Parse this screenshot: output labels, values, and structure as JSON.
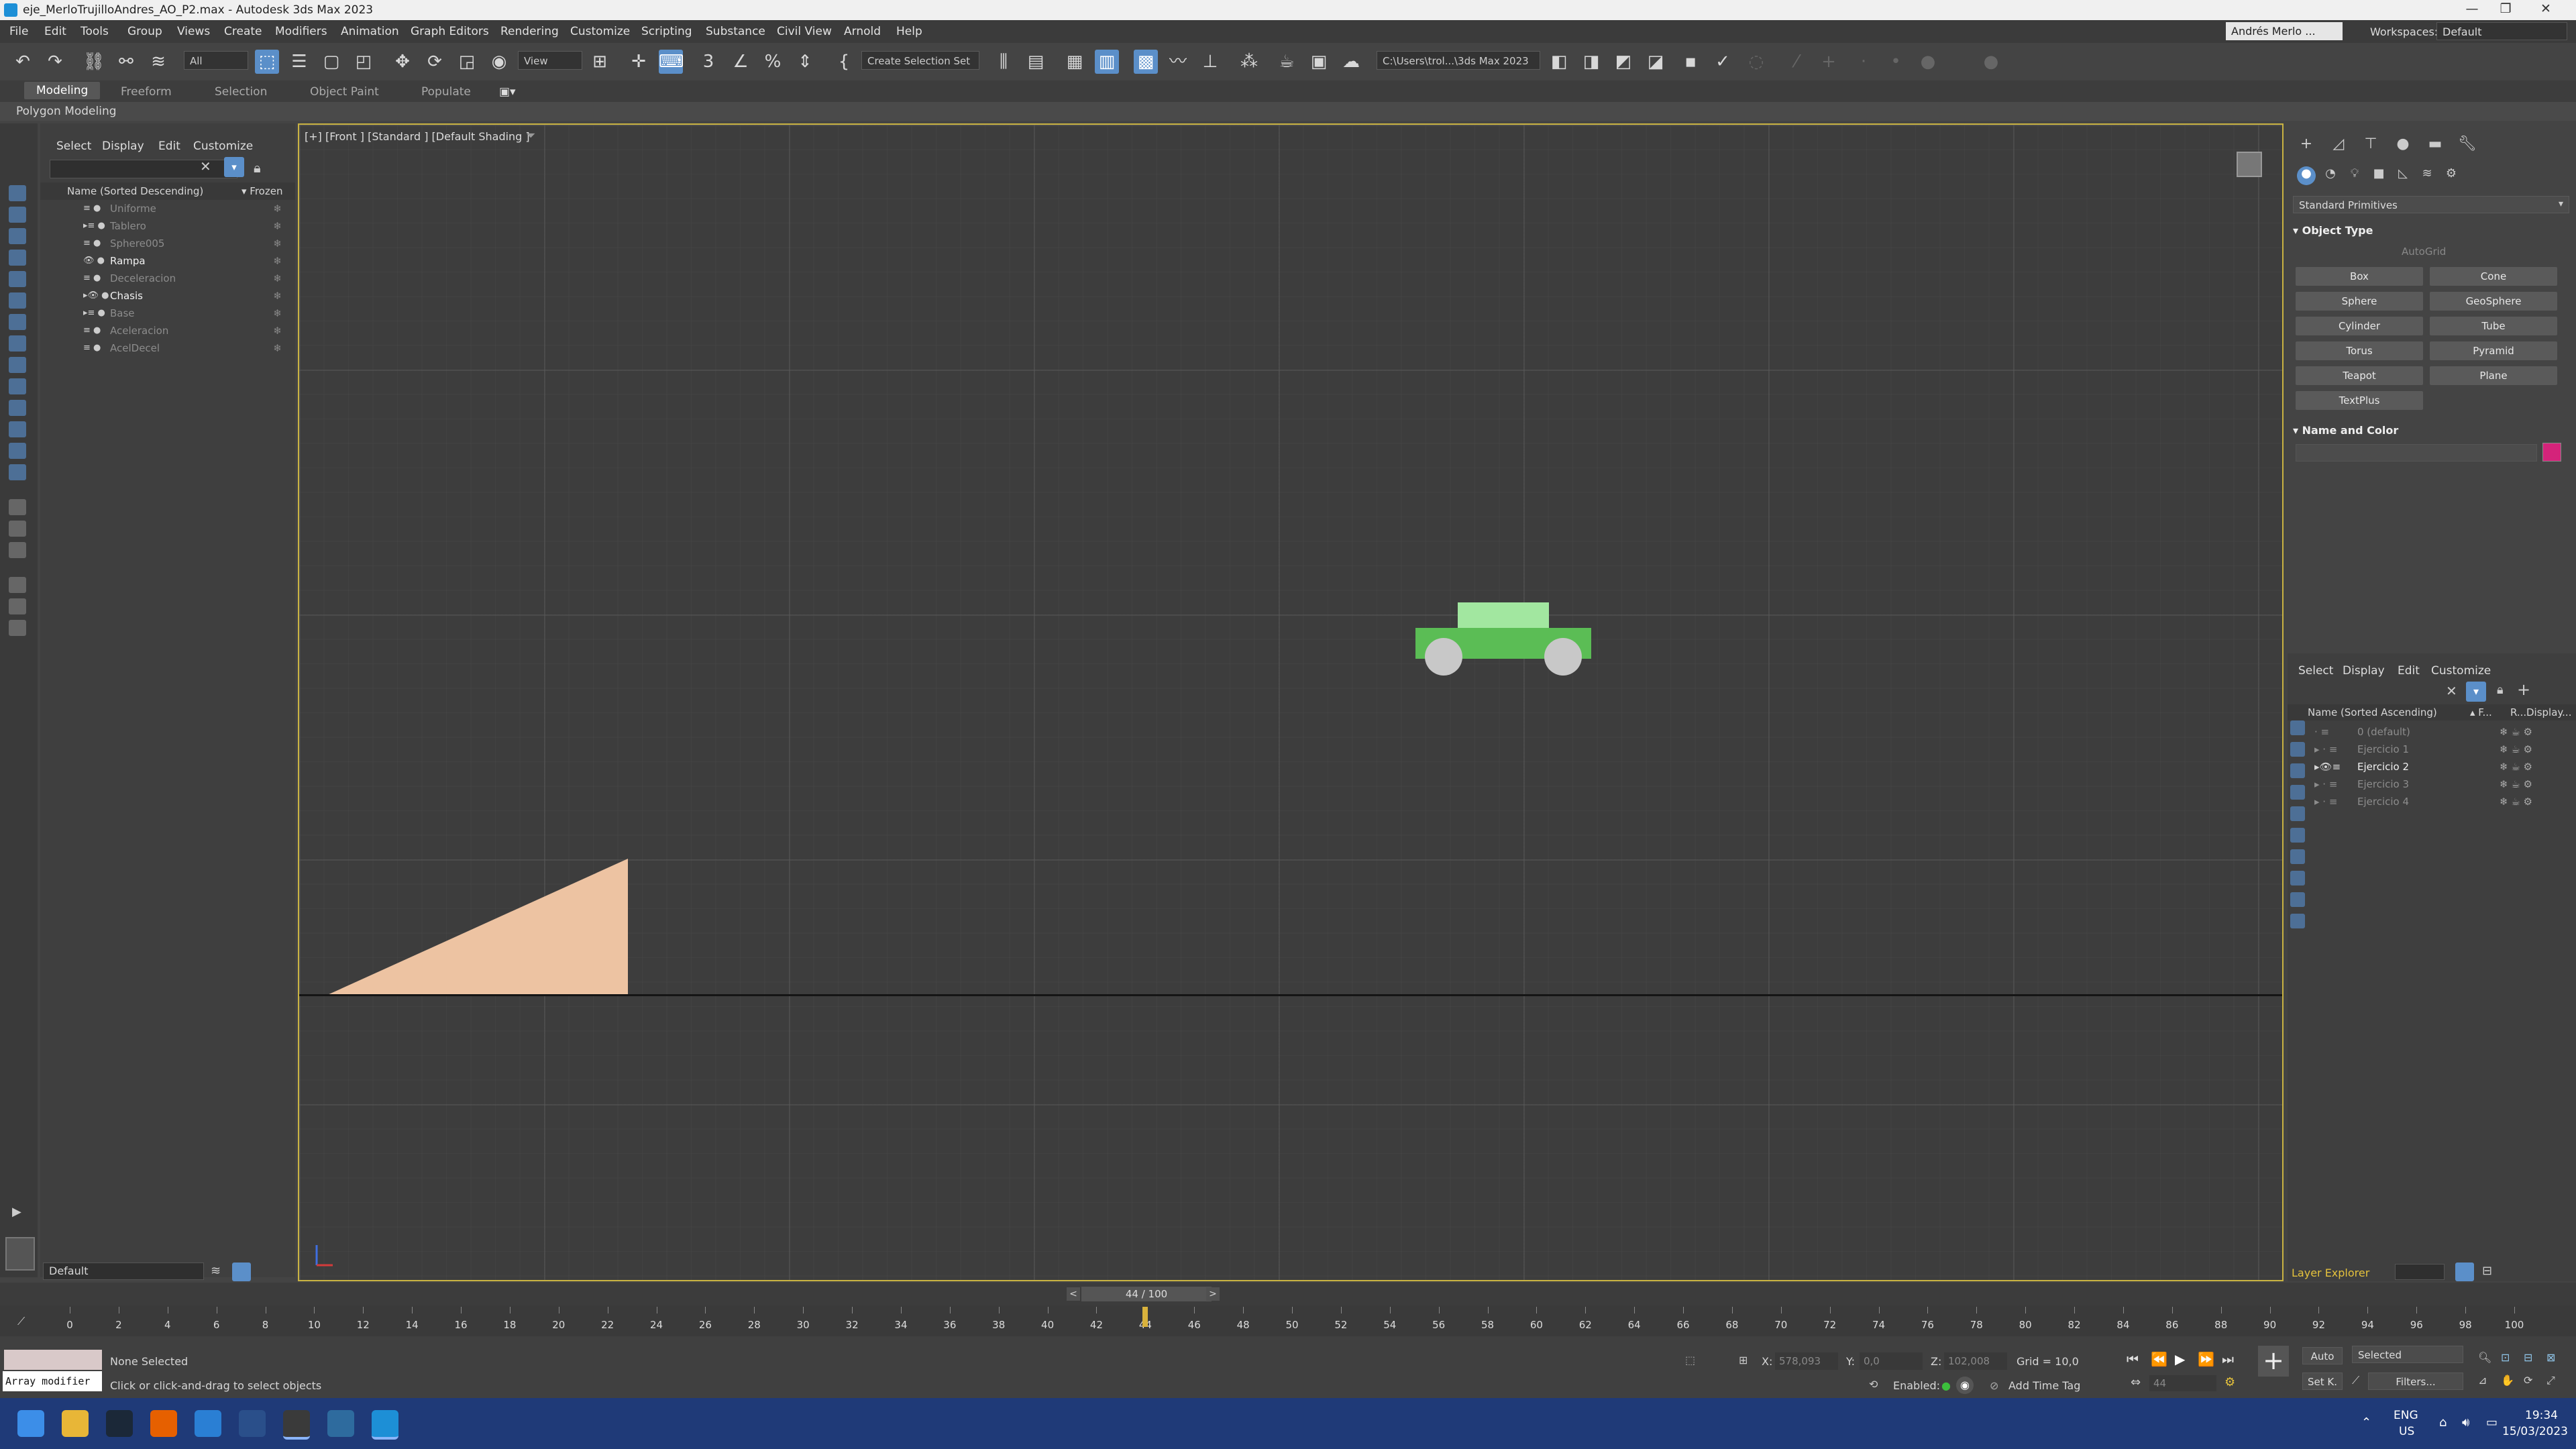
{
  "window": {
    "title": "eje_MerloTrujilloAndres_AO_P2.max - Autodesk 3ds Max 2023",
    "minimize": "—",
    "maximize": "❐",
    "close": "✕"
  },
  "menu": [
    "File",
    "Edit",
    "Tools",
    "Group",
    "Views",
    "Create",
    "Modifiers",
    "Animation",
    "Graph Editors",
    "Rendering",
    "Customize",
    "Scripting",
    "Substance",
    "Civil View",
    "Arnold",
    "Help"
  ],
  "user": {
    "name": "Andrés Merlo ..."
  },
  "workspace": {
    "label": "Workspaces:",
    "value": "Default"
  },
  "toolbar": {
    "selection_filter": "All",
    "reference_coord": "View",
    "named_selection": "Create Selection Set",
    "project_path": "C:\\Users\\trol...\\3ds Max 2023"
  },
  "ribbon": {
    "tabs": [
      "Modeling",
      "Freeform",
      "Selection",
      "Object Paint",
      "Populate"
    ],
    "active": "Modeling",
    "sub_label": "Polygon Modeling"
  },
  "scene_explorer": {
    "menu": [
      "Select",
      "Display",
      "Edit",
      "Customize"
    ],
    "col_name": "Name (Sorted Descending)",
    "col_frozen": "▾ Frozen",
    "items": [
      {
        "name": "Uniforme",
        "active": false
      },
      {
        "name": "Tablero",
        "active": false
      },
      {
        "name": "Sphere005",
        "active": false
      },
      {
        "name": "Rampa",
        "active": true
      },
      {
        "name": "Deceleracion",
        "active": false
      },
      {
        "name": "Chasis",
        "active": true
      },
      {
        "name": "Base",
        "active": false
      },
      {
        "name": "Aceleracion",
        "active": false
      },
      {
        "name": "AcelDecel",
        "active": false
      }
    ],
    "layer_value": "Default"
  },
  "viewport": {
    "label": "[+] [Front ] [Standard ] [Default Shading ]",
    "colors": {
      "ramp": "#edc3a2",
      "car_body": "#5bbd55",
      "car_cabin": "#a2e7a0",
      "wheel": "#c8c8c8",
      "active_border": "#c9b342"
    }
  },
  "command_panel": {
    "dropdown": "Standard Primitives",
    "object_type_title": "Object Type",
    "autogrid": "AutoGrid",
    "buttons": [
      "Box",
      "Cone",
      "Sphere",
      "GeoSphere",
      "Cylinder",
      "Tube",
      "Torus",
      "Pyramid",
      "Teapot",
      "Plane",
      "TextPlus"
    ],
    "name_color_title": "Name and Color",
    "swatch_color": "#d4237a"
  },
  "layer_explorer": {
    "menu": [
      "Select",
      "Display",
      "Edit",
      "Customize"
    ],
    "col_name": "Name (Sorted Ascending)",
    "col_f": "▴ F...",
    "col_r": "R...",
    "col_display": "Display...",
    "items": [
      {
        "name": "0 (default)",
        "active": false
      },
      {
        "name": "Ejercicio 1",
        "active": false
      },
      {
        "name": "Ejercicio 2",
        "active": true
      },
      {
        "name": "Ejercicio 3",
        "active": false
      },
      {
        "name": "Ejercicio 4",
        "active": false
      }
    ],
    "footer_label": "Layer Explorer"
  },
  "timeline": {
    "counter": "44 / 100",
    "current_frame": 44,
    "total_frames": 100,
    "ticks": [
      "0",
      "2",
      "4",
      "6",
      "8",
      "10",
      "12",
      "14",
      "16",
      "18",
      "20",
      "22",
      "24",
      "26",
      "28",
      "30",
      "32",
      "34",
      "36",
      "38",
      "40",
      "42",
      "44",
      "46",
      "48",
      "50",
      "52",
      "54",
      "56",
      "58",
      "60",
      "62",
      "64",
      "66",
      "68",
      "70",
      "72",
      "74",
      "76",
      "78",
      "80",
      "82",
      "84",
      "86",
      "88",
      "90",
      "92",
      "94",
      "96",
      "98",
      "100"
    ]
  },
  "status": {
    "script_box": "Array modifier",
    "selection": "None Selected",
    "prompt": "Click or click-and-drag to select objects",
    "x_label": "X:",
    "x_value": "578,093",
    "y_label": "Y:",
    "y_value": "0,0",
    "z_label": "Z:",
    "z_value": "102,008",
    "grid": "Grid = 10,0",
    "enabled": "Enabled:",
    "add_time_tag": "Add Time Tag",
    "auto": "Auto",
    "selected_dropdown": "Selected",
    "setk": "Set K.",
    "filters": "Filters...",
    "frame_spinner": "44"
  },
  "taskbar": {
    "lang": "ENG",
    "region": "US",
    "time": "19:34",
    "date": "15/03/2023"
  }
}
